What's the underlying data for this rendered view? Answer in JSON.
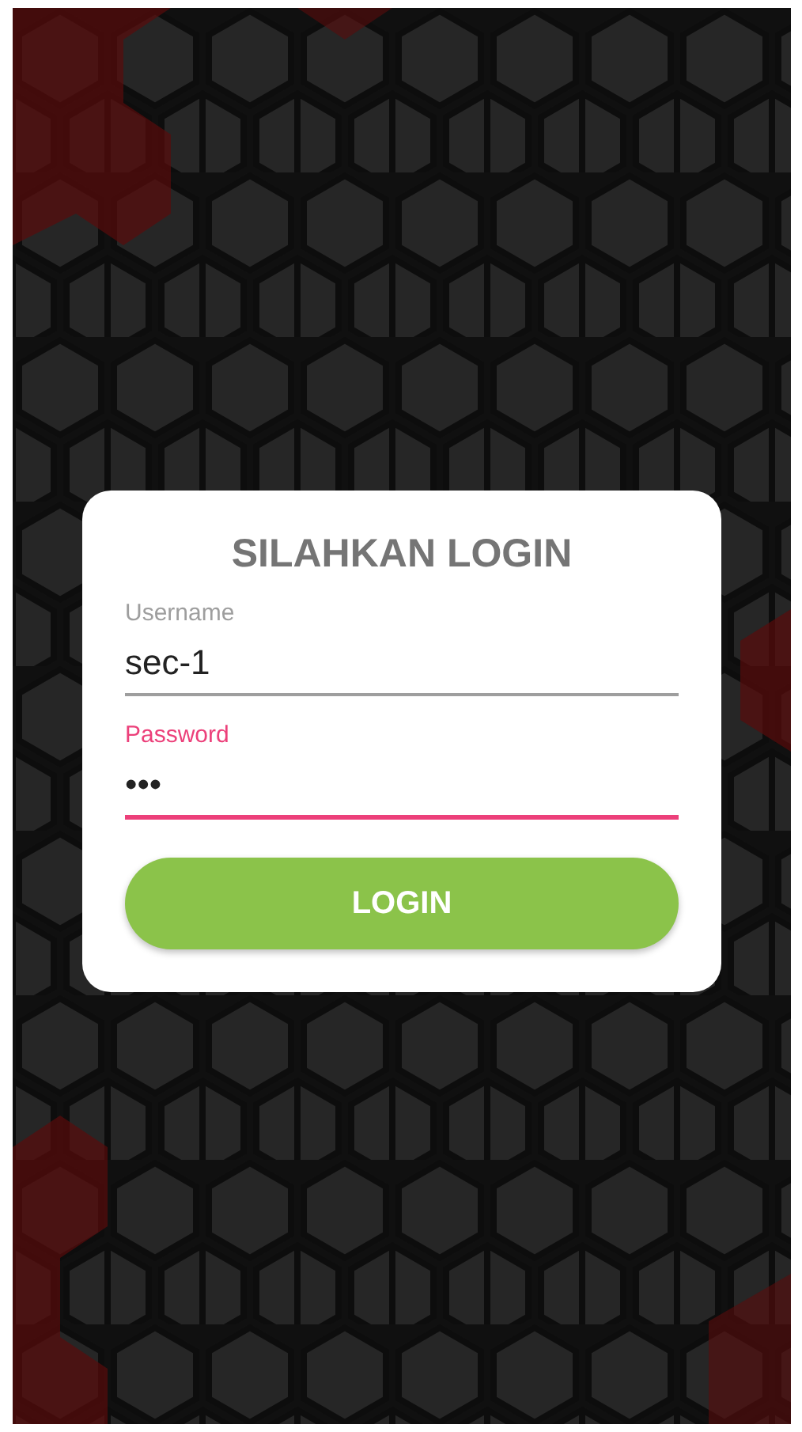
{
  "login_card": {
    "title": "SILAHKAN LOGIN",
    "fields": [
      {
        "label": "Username",
        "value": "sec-1",
        "focused": false
      },
      {
        "label": "Password",
        "value": "•••",
        "focused": true
      }
    ],
    "button": "LOGIN"
  }
}
